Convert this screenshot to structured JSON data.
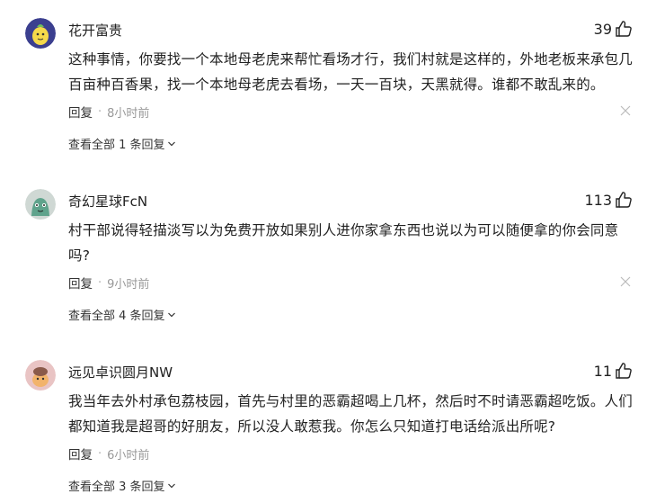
{
  "comments": [
    {
      "username": "花开富贵",
      "likes": "39",
      "text": "这种事情，你要找一个本地母老虎来帮忙看场才行，我们村就是这样的，外地老板来承包几百亩种百香果，找一个本地母老虎去看场，一天一百块，天黑就得。谁都不敢乱来的。",
      "reply_label": "回复",
      "time": "8小时前",
      "view_replies": "查看全部 1 条回复",
      "avatar_color": "#3b3f8f"
    },
    {
      "username": "奇幻星球FcN",
      "likes": "113",
      "text": "村干部说得轻描淡写以为免费开放如果别人进你家拿东西也说以为可以随便拿的你会同意吗?",
      "reply_label": "回复",
      "time": "9小时前",
      "view_replies": "查看全部 4 条回复",
      "avatar_color": "#4a7c6f"
    },
    {
      "username": "远见卓识圆月NW",
      "likes": "11",
      "text": "我当年去外村承包荔枝园，首先与村里的恶霸超喝上几杯，然后时不时请恶霸超吃饭。人们都知道我是超哥的好朋友，所以没人敢惹我。你怎么只知道打电话给派出所呢?",
      "reply_label": "回复",
      "time": "6小时前",
      "view_replies": "查看全部 3 条回复",
      "avatar_color": "#c98b8b"
    }
  ]
}
